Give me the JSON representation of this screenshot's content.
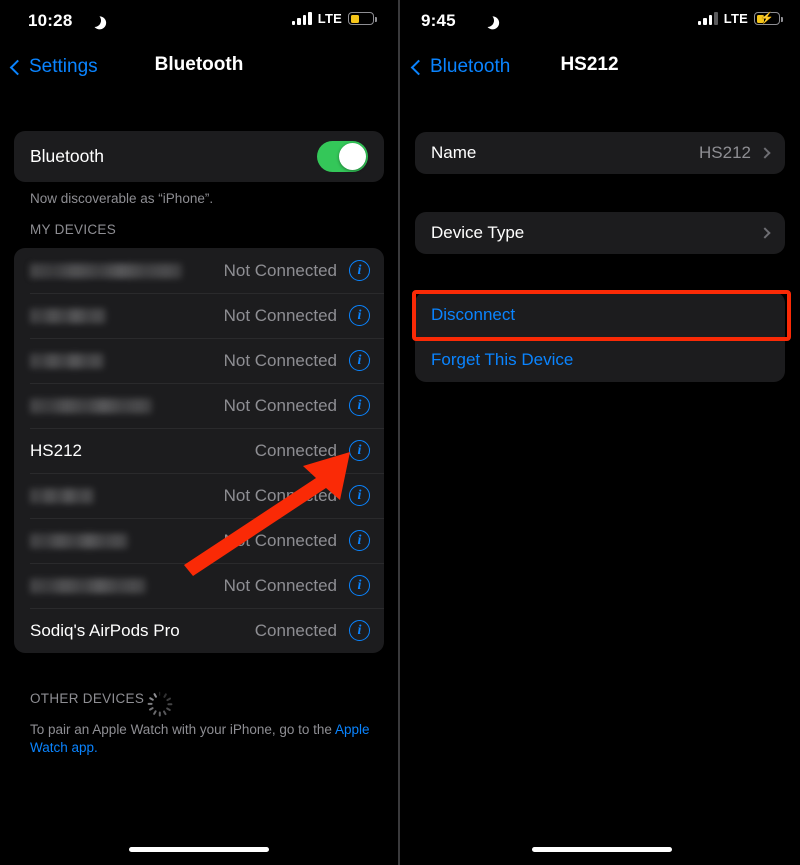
{
  "left": {
    "status_bar": {
      "time": "10:28",
      "moon_icon": "moon-crescent-icon",
      "signal_icon": "cellular-signal-icon",
      "signal_bars": 4,
      "network": "LTE",
      "battery_icon": "battery-low-power-icon",
      "battery_level_pct": 40,
      "battery_charging": false
    },
    "nav": {
      "back_label": "Settings",
      "back_icon": "chevron-left-icon",
      "title": "Bluetooth"
    },
    "bluetooth_toggle": {
      "label": "Bluetooth",
      "state": "on",
      "accent_color": "#34c759"
    },
    "discoverable_note": "Now discoverable as “iPhone”.",
    "my_devices_header": "MY DEVICES",
    "devices": [
      {
        "name": "",
        "redacted": true,
        "redact_width": 152,
        "status": "Not Connected",
        "info_icon": "info-circle-icon"
      },
      {
        "name": "",
        "redacted": true,
        "redact_width": 76,
        "status": "Not Connected",
        "info_icon": "info-circle-icon"
      },
      {
        "name": "",
        "redacted": true,
        "redact_width": 74,
        "status": "Not Connected",
        "info_icon": "info-circle-icon"
      },
      {
        "name": "",
        "redacted": true,
        "redact_width": 122,
        "status": "Not Connected",
        "info_icon": "info-circle-icon"
      },
      {
        "name": "HS212",
        "redacted": false,
        "redact_width": 0,
        "status": "Connected",
        "info_icon": "info-circle-icon"
      },
      {
        "name": "",
        "redacted": true,
        "redact_width": 64,
        "status": "Not Connected",
        "info_icon": "info-circle-icon"
      },
      {
        "name": "",
        "redacted": true,
        "redact_width": 98,
        "status": "Not Connected",
        "info_icon": "info-circle-icon"
      },
      {
        "name": "",
        "redacted": true,
        "redact_width": 116,
        "status": "Not Connected",
        "info_icon": "info-circle-icon"
      },
      {
        "name": "Sodiq's AirPods Pro",
        "redacted": false,
        "redact_width": 0,
        "status": "Connected",
        "info_icon": "info-circle-icon"
      }
    ],
    "other_devices_header": "OTHER DEVICES",
    "other_devices_spinner": "loading-spinner-icon",
    "pair_note_line1": "To pair an Apple Watch with your iPhone, go to the",
    "pair_note_link": "Apple Watch app."
  },
  "right": {
    "status_bar": {
      "time": "9:45",
      "moon_icon": "moon-crescent-icon",
      "signal_icon": "cellular-signal-icon",
      "signal_bars": 3,
      "network": "LTE",
      "battery_icon": "battery-charging-icon",
      "battery_level_pct": 35,
      "battery_charging": true,
      "charging_icon": "lightning-bolt-icon"
    },
    "nav": {
      "back_label": "Bluetooth",
      "back_icon": "chevron-left-icon",
      "title": "HS212"
    },
    "rows": [
      {
        "label": "Name",
        "value": "HS212",
        "chevron_icon": "chevron-right-icon"
      },
      {
        "label": "Device Type",
        "value": "",
        "chevron_icon": "chevron-right-icon"
      }
    ],
    "actions": [
      {
        "label": "Disconnect",
        "highlighted": true
      },
      {
        "label": "Forget This Device",
        "highlighted": false
      }
    ]
  },
  "annotations": {
    "arrow_color": "#fa2a06",
    "highlight_color": "#fa2a06",
    "arrow_name": "pointer-arrow-to-info-icon",
    "highlight_name": "disconnect-highlight-box"
  },
  "colors": {
    "accent_blue": "#0a84ff",
    "card_bg": "#1c1c1e",
    "secondary_text": "#8e8e93",
    "page_bg": "#000000"
  }
}
